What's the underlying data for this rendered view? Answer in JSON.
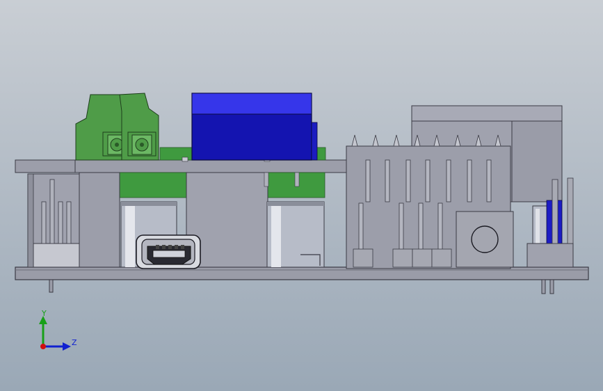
{
  "viewport": {
    "background_top": "#c9ced4",
    "background_bottom": "#9aa8b6"
  },
  "colors": {
    "board_gray": "#9c9eaa",
    "board_edge": "#3a3a44",
    "pcb_green": "#3f9a3f",
    "terminal_green": "#4f9c48",
    "relay_blue": "#1414b0",
    "relay_blue_top": "#3636ea",
    "capacitor": "#b7bcc8"
  },
  "triad": {
    "y_label": "Y",
    "z_label": "Z",
    "x_axis_color": "#d01010",
    "y_axis_color": "#18a018",
    "z_axis_color": "#1020d0"
  },
  "icons": {
    "origin": "coordinate-triad-icon"
  }
}
